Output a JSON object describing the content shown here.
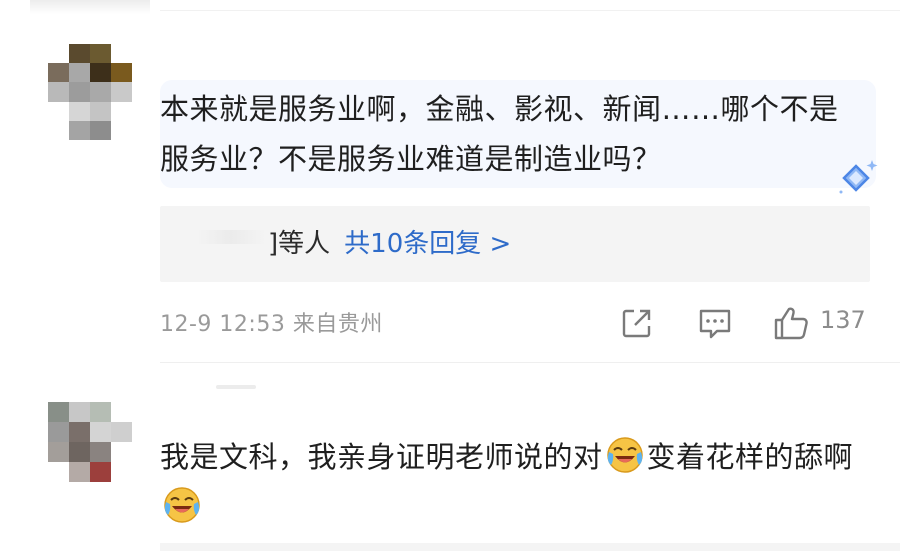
{
  "comment1": {
    "text": "本来就是服务业啊，金融、影视、新闻……哪个不是服务业？不是服务业难道是制造业吗？",
    "replies": {
      "prefix_text": "]等人",
      "link_text": "共10条回复 >"
    },
    "meta": "12-9 12:53 来自贵州",
    "like_count": "137",
    "icons": [
      "share-icon",
      "comment-icon",
      "like-icon"
    ]
  },
  "comment2": {
    "text_part1": "我是文科，我亲身证明老师说的对",
    "text_part2": "变着花样的舔啊",
    "emoji": "laughing-crying-emoji"
  },
  "colors": {
    "link_blue": "#2e6bc9",
    "meta_gray": "#9a9a9a",
    "bubble_bg": "#f5f8fe",
    "reply_bg": "#f4f4f4"
  }
}
